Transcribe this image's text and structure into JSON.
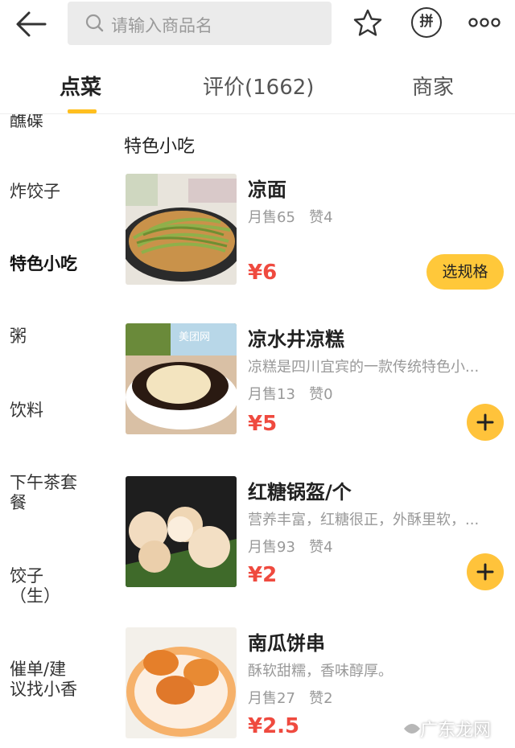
{
  "header": {
    "search_placeholder": "请输入商品名",
    "pin_label": "拼",
    "icons": [
      "back-arrow-icon",
      "search-icon",
      "star-icon",
      "more-icon"
    ]
  },
  "tabs": [
    {
      "label": "点菜",
      "active": true
    },
    {
      "label": "评价(1662)",
      "active": false
    },
    {
      "label": "商家",
      "active": false
    }
  ],
  "sidebar": {
    "items": [
      {
        "label": "醮碟"
      },
      {
        "label": "炸饺子"
      },
      {
        "label": "特色小吃",
        "active": true
      },
      {
        "label": "粥"
      },
      {
        "label": "饮料"
      },
      {
        "label_l1": "下午茶套",
        "label_l2": "餐"
      },
      {
        "label_l1": "饺子",
        "label_l2": "（生）"
      },
      {
        "label_l1": "催单/建",
        "label_l2": "议找小香"
      }
    ]
  },
  "section_title": "特色小吃",
  "products": [
    {
      "name": "凉面",
      "desc": "",
      "sales": "月售65",
      "likes": "赞4",
      "price": "¥6",
      "action": "选规格"
    },
    {
      "name": "凉水井凉糕",
      "desc": "凉糕是四川宜宾的一款传统特色小...",
      "sales": "月售13",
      "likes": "赞0",
      "price": "¥5",
      "action": "+",
      "thumb_badge": "美团网"
    },
    {
      "name": "红糖锅盔/个",
      "desc": "营养丰富，红糖很正，外酥里软，...",
      "sales": "月售93",
      "likes": "赞4",
      "price": "¥2",
      "action": "+"
    },
    {
      "name": "南瓜饼串",
      "desc": "酥软甜糯，香味醇厚。",
      "sales": "月售27",
      "likes": "赞2",
      "price": "¥2.5",
      "action": "+"
    }
  ],
  "watermark": "广东龙网",
  "colors": {
    "accent": "#ffc33b",
    "price": "#ef4a3f",
    "muted": "#999999"
  }
}
